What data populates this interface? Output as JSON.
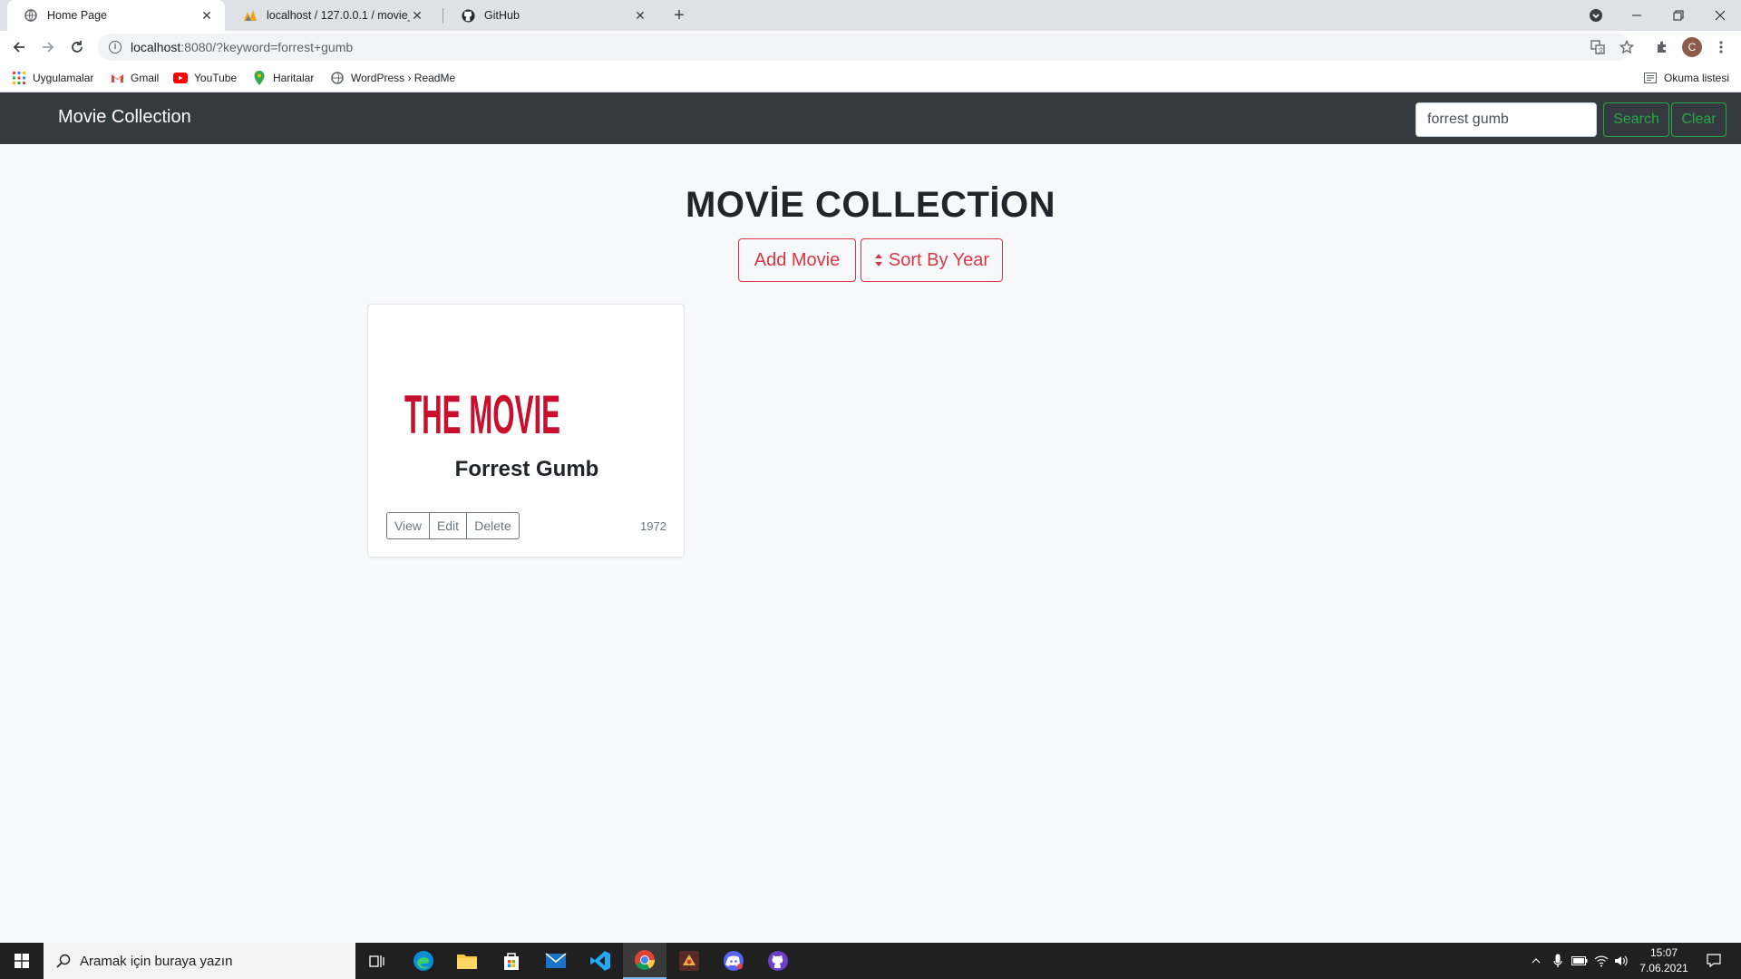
{
  "browser": {
    "tabs": [
      {
        "title": "Home Page",
        "active": true
      },
      {
        "title": "localhost / 127.0.0.1 / movie_coll",
        "active": false
      },
      {
        "title": "GitHub",
        "active": false
      }
    ],
    "url": {
      "host": "localhost",
      "rest": ":8080/?keyword=forrest+gumb"
    },
    "profile_initial": "C",
    "bookmarks": [
      "Uygulamalar",
      "Gmail",
      "YouTube",
      "Haritalar",
      "WordPress › ReadMe"
    ],
    "reading_list": "Okuma listesi"
  },
  "site": {
    "brand": "Movie Collection",
    "search": {
      "value": "forrest gumb",
      "button": "Search"
    },
    "clear_button": "Clear",
    "heading": "MOVİE COLLECTİON",
    "add_movie_button": "Add Movie",
    "sort_button": "Sort By Year",
    "movies": [
      {
        "poster_text": "THE MOVIE",
        "title": "Forrest Gumb",
        "year": "1972",
        "actions": {
          "view": "View",
          "edit": "Edit",
          "delete": "Delete"
        }
      }
    ],
    "colors": {
      "navbar": "#343a40",
      "success": "#28a745",
      "danger": "#dc3545",
      "secondary": "#6c757d",
      "poster_red": "#c8102e"
    }
  },
  "taskbar": {
    "search_placeholder": "Aramak için buraya yazın",
    "time": "15:07",
    "date": "7.06.2021",
    "apps": [
      "task-view-icon",
      "edge-icon",
      "file-explorer-icon",
      "store-icon",
      "mail-icon",
      "vscode-icon",
      "chrome-icon",
      "game-icon",
      "discord-icon",
      "github-desktop-icon"
    ]
  }
}
